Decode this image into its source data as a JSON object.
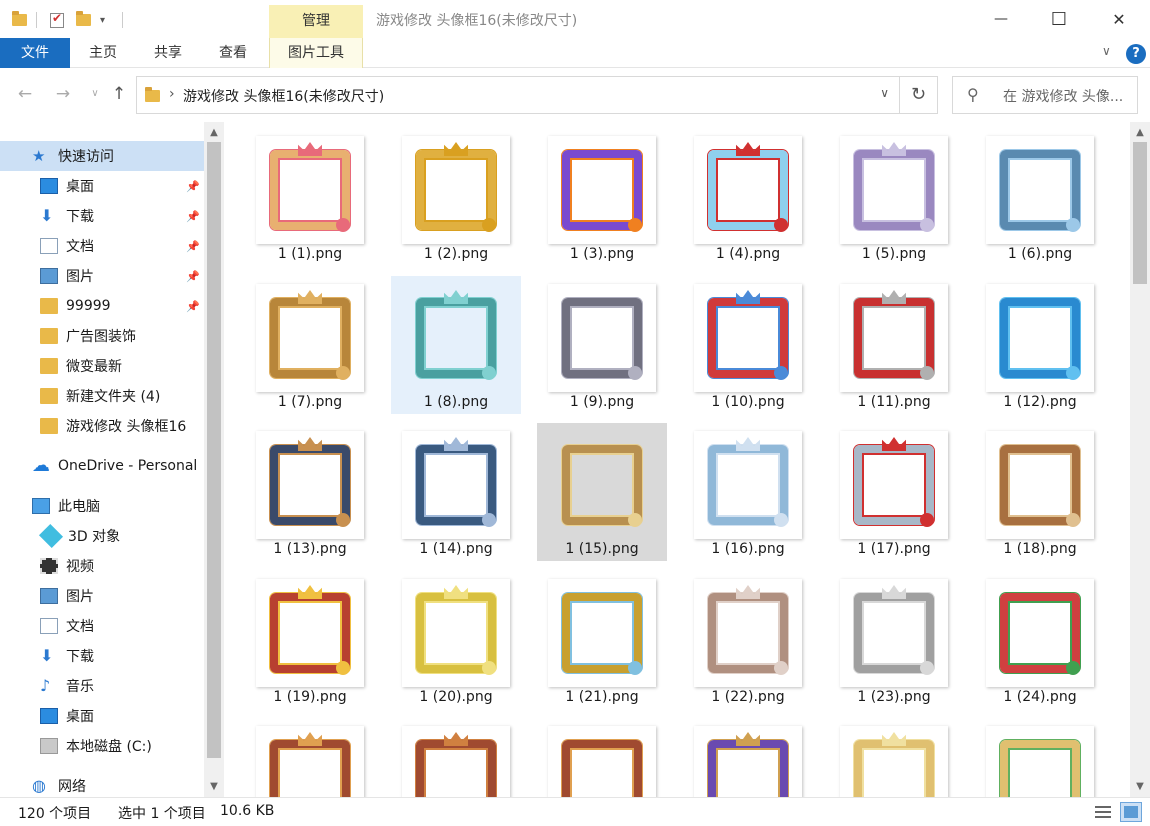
{
  "window": {
    "title": "游戏修改   头像框16(未修改尺寸)",
    "manage_tab": "管理",
    "minimize": "—",
    "maximize": "☐",
    "close": "✕"
  },
  "ribbon": {
    "tabs": [
      "文件",
      "主页",
      "共享",
      "查看",
      "图片工具"
    ],
    "help": "?"
  },
  "address": {
    "path": "游戏修改   头像框16(未修改尺寸)",
    "search_placeholder": "在 游戏修改   头像..."
  },
  "nav": {
    "items": [
      {
        "label": "快速访问",
        "icon": "star-icon"
      },
      {
        "label": "桌面",
        "icon": "desktop-icon",
        "pinned": true
      },
      {
        "label": "下载",
        "icon": "download-icon",
        "pinned": true
      },
      {
        "label": "文档",
        "icon": "document-icon",
        "pinned": true
      },
      {
        "label": "图片",
        "icon": "picture-icon",
        "pinned": true
      },
      {
        "label": "99999",
        "icon": "folder-icon",
        "pinned": true
      },
      {
        "label": "广告图装饰",
        "icon": "folder-icon"
      },
      {
        "label": "微变最新",
        "icon": "folder-icon"
      },
      {
        "label": "新建文件夹 (4)",
        "icon": "folder-icon"
      },
      {
        "label": "游戏修改   头像框16",
        "icon": "folder-icon"
      },
      {
        "label": "OneDrive - Personal",
        "icon": "cloud-icon"
      },
      {
        "label": "此电脑",
        "icon": "computer-icon"
      },
      {
        "label": "3D 对象",
        "icon": "3d-objects-icon"
      },
      {
        "label": "视频",
        "icon": "video-icon"
      },
      {
        "label": "图片",
        "icon": "picture-icon"
      },
      {
        "label": "文档",
        "icon": "document-icon"
      },
      {
        "label": "下载",
        "icon": "download-icon"
      },
      {
        "label": "音乐",
        "icon": "music-icon"
      },
      {
        "label": "桌面",
        "icon": "desktop-icon"
      },
      {
        "label": "本地磁盘 (C:)",
        "icon": "drive-icon"
      },
      {
        "label": "网络",
        "icon": "network-icon"
      }
    ]
  },
  "files": [
    {
      "name": "1 (1).png",
      "color": "#e8b070",
      "accent": "#e86a7a"
    },
    {
      "name": "1 (2).png",
      "color": "#e0b040",
      "accent": "#d9a020"
    },
    {
      "name": "1 (3).png",
      "color": "#7a4ad0",
      "accent": "#f08020"
    },
    {
      "name": "1 (4).png",
      "color": "#8fd0ee",
      "accent": "#d03030"
    },
    {
      "name": "1 (5).png",
      "color": "#9a88c0",
      "accent": "#c8c0e0"
    },
    {
      "name": "1 (6).png",
      "color": "#5a8ab0",
      "accent": "#9cc8e8"
    },
    {
      "name": "1 (7).png",
      "color": "#b8863a",
      "accent": "#e0b060"
    },
    {
      "name": "1 (8).png",
      "color": "#4aa0a0",
      "accent": "#80d0d0"
    },
    {
      "name": "1 (9).png",
      "color": "#707080",
      "accent": "#b0b0c0"
    },
    {
      "name": "1 (10).png",
      "color": "#d03a3a",
      "accent": "#4a8ad8"
    },
    {
      "name": "1 (11).png",
      "color": "#c83030",
      "accent": "#b0b0b0"
    },
    {
      "name": "1 (12).png",
      "color": "#2a8ad0",
      "accent": "#60c0f0"
    },
    {
      "name": "1 (13).png",
      "color": "#3a4a6a",
      "accent": "#c89050"
    },
    {
      "name": "1 (14).png",
      "color": "#3a5a80",
      "accent": "#a0b8d8"
    },
    {
      "name": "1 (15).png",
      "color": "#b89050",
      "accent": "#e8d090"
    },
    {
      "name": "1 (16).png",
      "color": "#90b8d8",
      "accent": "#d0e0f0"
    },
    {
      "name": "1 (17).png",
      "color": "#a8b8c8",
      "accent": "#d03030"
    },
    {
      "name": "1 (18).png",
      "color": "#a87040",
      "accent": "#e0c090"
    },
    {
      "name": "1 (19).png",
      "color": "#b84030",
      "accent": "#f0c040"
    },
    {
      "name": "1 (20).png",
      "color": "#d8c040",
      "accent": "#f0e080"
    },
    {
      "name": "1 (21).png",
      "color": "#c8a030",
      "accent": "#80c0e0"
    },
    {
      "name": "1 (22).png",
      "color": "#b09080",
      "accent": "#e0d0c8"
    },
    {
      "name": "1 (23).png",
      "color": "#a0a0a0",
      "accent": "#d8d8d8"
    },
    {
      "name": "1 (24).png",
      "color": "#d04040",
      "accent": "#40a050"
    },
    {
      "name": "",
      "color": "#a04a30",
      "accent": "#e0a050"
    },
    {
      "name": "",
      "color": "#a04a30",
      "accent": "#d08040"
    },
    {
      "name": "",
      "color": "#a04a30",
      "accent": "#e0a050"
    },
    {
      "name": "",
      "color": "#6a4ab0",
      "accent": "#d0a050"
    },
    {
      "name": "",
      "color": "#e0c070",
      "accent": "#f0e0a0"
    },
    {
      "name": "",
      "color": "#e0c070",
      "accent": "#60b060"
    }
  ],
  "status": {
    "count": "120 个项目",
    "selected": "选中 1 个项目",
    "size": "10.6 KB"
  }
}
